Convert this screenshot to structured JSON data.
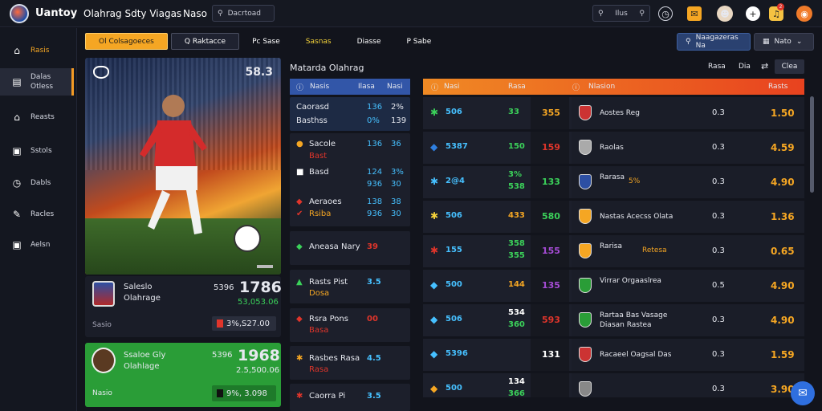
{
  "topbar": {
    "brand": "Uantoy",
    "nav1": "Olahrag Sdty Viagas",
    "nav2": "Naso",
    "search_placeholder": "Dacrtoad",
    "search2_label": "Ilus",
    "notif_badge": "2"
  },
  "sidebar": {
    "items": [
      {
        "label": "Rasis",
        "icon": "home-icon"
      },
      {
        "label": "Dalas Otless",
        "icon": "stats-icon"
      },
      {
        "label": "Reasts",
        "icon": "bank-icon"
      },
      {
        "label": "Sstols",
        "icon": "card-icon"
      },
      {
        "label": "Dabls",
        "icon": "clock-icon"
      },
      {
        "label": "Racles",
        "icon": "pen-icon"
      },
      {
        "label": "Aelsn",
        "icon": "wallet-icon"
      }
    ]
  },
  "tabs": [
    "Ol Colsagoeces",
    "Q Raktacce",
    "Pc Sase",
    "Sasnas",
    "Diasse",
    "P Sabe"
  ],
  "right_buttons": {
    "b1": "Naagazeras Na",
    "b2": "Nato"
  },
  "hero": {
    "value": "58.3"
  },
  "player_card": {
    "name": "Saleslo",
    "sub": "Olahrage",
    "label1": "5396",
    "score": "1786",
    "green_val": "53,053.06",
    "foot": "Sasio",
    "amount": "3%,S27.00"
  },
  "green_card": {
    "name": "Ssaloe Gly",
    "sub": "Olahlage",
    "label1": "5396",
    "score": "1968",
    "green_val": "2.5,500.06",
    "foot": "Nasio",
    "amount": "9%, 3.098"
  },
  "section_title": "Matarda Olahrag",
  "filters": [
    "Rasa",
    "Dia",
    "Clea"
  ],
  "blue_head": {
    "c1": "Nasis",
    "c2": "Ilasa",
    "c3": "Nasi"
  },
  "odds_blocks": [
    {
      "rows": [
        {
          "n": "Caorasd",
          "a": "136",
          "b": "2%"
        },
        {
          "n": "Basthss",
          "a": "0%",
          "b": "139"
        }
      ]
    },
    {
      "rows": [
        {
          "n": "Sacole",
          "a": "136",
          "b": "36"
        },
        {
          "n": "Bast",
          "a": "",
          "b": ""
        },
        {
          "n": "Basd",
          "a": "124",
          "b": "3%"
        },
        {
          "n": "",
          "a": "936",
          "b": "30"
        },
        {
          "n": "Aeraoes",
          "a": "138",
          "b": "38"
        },
        {
          "n": "Rsiba",
          "a": "936",
          "b": "30"
        }
      ]
    },
    {
      "rows": [
        {
          "n": "Aneasa Nary",
          "a": "39"
        }
      ]
    },
    {
      "rows": [
        {
          "n": "Rasts Pist",
          "a": "3.5"
        },
        {
          "n": "Dosa",
          "a": ""
        }
      ]
    },
    {
      "rows": [
        {
          "n": "Rsra Pons",
          "a": "00"
        },
        {
          "n": "Basa",
          "a": ""
        }
      ]
    },
    {
      "rows": [
        {
          "n": "Rasbes Rasa",
          "a": "4.5"
        },
        {
          "n": "Rasa",
          "a": ""
        }
      ]
    },
    {
      "rows": [
        {
          "n": "Caorra Pi",
          "a": "3.5"
        },
        {
          "n": "",
          "a": ""
        }
      ]
    }
  ],
  "orange_head": {
    "c1": "Nasi",
    "c2": "Rasa",
    "c3": "Nlasion",
    "c4": "Rasts"
  },
  "mid_rows": [
    {
      "a": "506",
      "b": "33",
      "c": "355"
    },
    {
      "a": "5387",
      "b": "150",
      "c": "159"
    },
    {
      "a": "2@4",
      "b": "3%",
      "b2": "538",
      "c": "133"
    },
    {
      "a": "506",
      "b": "433",
      "c": "580"
    },
    {
      "a": "155",
      "b": "358",
      "b2": "355",
      "c": "155"
    },
    {
      "a": "500",
      "b": "144",
      "c": "135"
    },
    {
      "a": "506",
      "b": "534",
      "b2": "360",
      "c": "593"
    },
    {
      "a": "5396",
      "b": "",
      "c": "131"
    },
    {
      "a": "500",
      "b": "134",
      "b2": "366",
      "c": ""
    }
  ],
  "team_rows": [
    {
      "name": "Aostes Reg",
      "o1": "0.3",
      "o2": "1.50"
    },
    {
      "name": "Raolas",
      "o1": "0.3",
      "o2": "4.59"
    },
    {
      "name": "Rarasa",
      "extra": "5%",
      "o1": "0.3",
      "o2": "4.90"
    },
    {
      "name": "Nastas Acecss Olata",
      "o1": "0.3",
      "o2": "1.36"
    },
    {
      "name": "Rarisa",
      "extra": "Retesa",
      "o1": "0.3",
      "o2": "0.65"
    },
    {
      "name": "Virrar Orgaaslrea",
      "o1": "0.5",
      "o2": "4.90"
    },
    {
      "name": "Rartaa Bas Vasage Diasan Rastea",
      "o1": "0.3",
      "o2": "4.90"
    },
    {
      "name": "Racaeel Oagsal Das",
      "o1": "0.3",
      "o2": "1.59"
    },
    {
      "name": "",
      "o1": "0.3",
      "o2": "3.90"
    }
  ]
}
